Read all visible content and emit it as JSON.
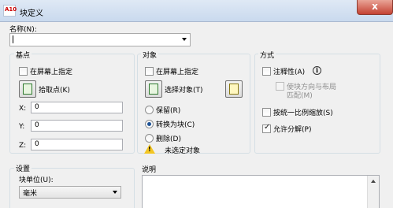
{
  "window": {
    "app_icon_text": "A10",
    "title": "块定义",
    "close_glyph": "x"
  },
  "name": {
    "label": "名称(N):",
    "value": ""
  },
  "base_point": {
    "group": "基点",
    "specify_on_screen": "在屏幕上指定",
    "pick_point": "拾取点(K)",
    "x_label": "X:",
    "x_value": "0",
    "y_label": "Y:",
    "y_value": "0",
    "z_label": "Z:",
    "z_value": "0"
  },
  "objects": {
    "group": "对象",
    "specify_on_screen": "在屏幕上指定",
    "select_objects": "选择对象(T)",
    "retain": "保留(R)",
    "convert_to_block": "转换为块(C)",
    "delete": "删除(D)",
    "warning": "未选定对象",
    "selected_option": "convert_to_block"
  },
  "behavior": {
    "group": "方式",
    "annotative": "注释性(A)",
    "match_orientation": "使块方向与布局",
    "match_orientation_2": "匹配(M)",
    "scale_uniformly": "按统一比例缩放(S)",
    "allow_exploding": "允许分解(P)",
    "allow_exploding_checked": true
  },
  "settings": {
    "group": "设置",
    "unit_label": "块单位(U):",
    "unit_value": "毫米"
  },
  "description": {
    "label": "说明",
    "value": ""
  }
}
